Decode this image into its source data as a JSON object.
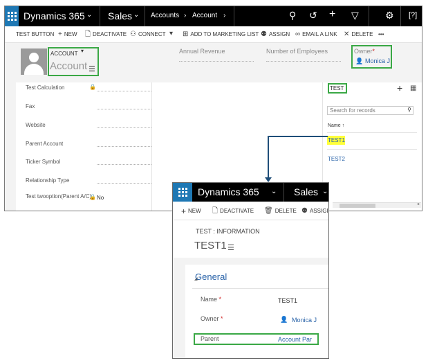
{
  "app": {
    "name": "Dynamics 365",
    "area": "Sales",
    "breadcrumb": [
      "Accounts",
      "Account"
    ]
  },
  "main_commands": [
    {
      "label": "TEST BUTTON",
      "icon": ""
    },
    {
      "label": "NEW",
      "icon": "plus-icon"
    },
    {
      "label": "DEACTIVATE",
      "icon": "document-deactivate-icon"
    },
    {
      "label": "CONNECT",
      "icon": "connect-icon"
    },
    {
      "label": "ADD TO MARKETING LIST",
      "icon": "marketing-list-icon"
    },
    {
      "label": "ASSIGN",
      "icon": "assign-icon"
    },
    {
      "label": "EMAIL A LINK",
      "icon": "link-icon"
    },
    {
      "label": "DELETE",
      "icon": "delete-x-icon"
    },
    {
      "label": "•••",
      "icon": ""
    }
  ],
  "header": {
    "entity_label": "ACCOUNT",
    "record_name": "Account",
    "annual_revenue_label": "Annual Revenue",
    "employees_label": "Number of Employees",
    "owner_label": "Owner",
    "owner_value": "Monica J"
  },
  "form_fields": [
    {
      "label": "Test Calculation",
      "value": "",
      "locked": true
    },
    {
      "label": "Fax",
      "value": ""
    },
    {
      "label": "Website",
      "value": ""
    },
    {
      "label": "Parent Account",
      "value": ""
    },
    {
      "label": "Ticker Symbol",
      "value": ""
    },
    {
      "label": "Relationship Type",
      "value": ""
    },
    {
      "label": "Test twooption(Parent A/C)",
      "value": "No",
      "locked": true
    }
  ],
  "subgrid": {
    "title": "TEST",
    "search_placeholder": "Search for records",
    "column": "Name ↑",
    "rows": [
      "TEST1",
      "TEST2"
    ]
  },
  "popup": {
    "app_name": "Dynamics 365",
    "area": "Sales",
    "commands": [
      {
        "label": "NEW"
      },
      {
        "label": "DEACTIVATE"
      },
      {
        "label": "DELETE"
      },
      {
        "label": "ASSIGI"
      }
    ],
    "record_label": "TEST : INFORMATION",
    "record_title": "TEST1",
    "section": "General",
    "fields": [
      {
        "label": "Name",
        "value": "TEST1"
      },
      {
        "label": "Owner",
        "value": "Monica J"
      },
      {
        "label": "Parent",
        "value": "Account Par"
      }
    ]
  },
  "colors": {
    "accent": "#1e78b4",
    "link": "#2862a8",
    "highlight_box": "#3aa845",
    "highlight_fill": "#ffff3a",
    "arrow": "#1f4e79"
  }
}
